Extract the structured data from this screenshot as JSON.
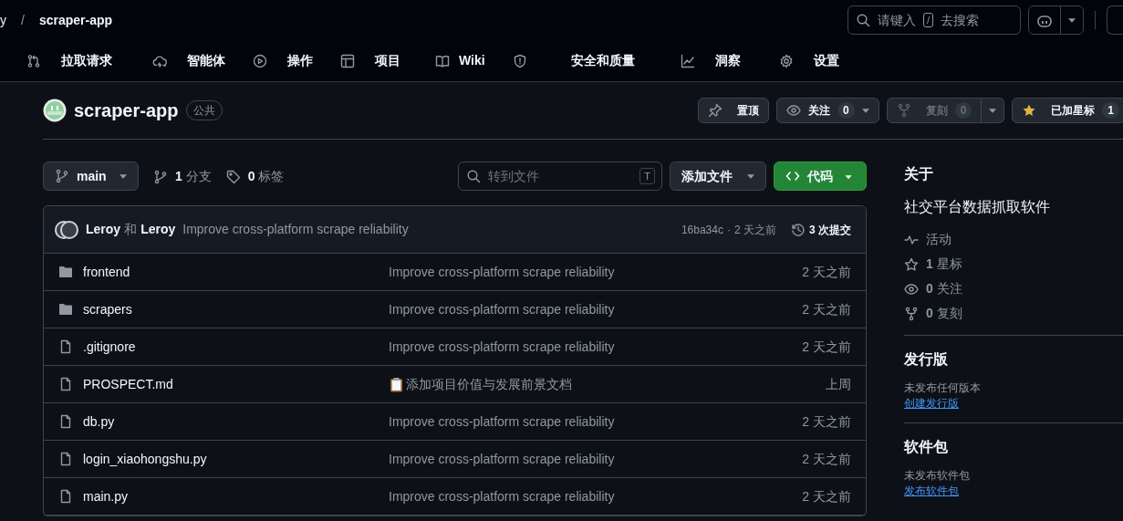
{
  "header": {
    "owner": "y",
    "separator": "/",
    "repo": "scraper-app",
    "search": {
      "before": "请键入",
      "key": "/",
      "after": "去搜索"
    }
  },
  "tabs": [
    {
      "kind": "pulls",
      "label": "拉取请求"
    },
    {
      "kind": "agents",
      "label": "智能体"
    },
    {
      "kind": "actions",
      "label": "操作"
    },
    {
      "kind": "projects",
      "label": "项目"
    },
    {
      "kind": "wiki",
      "label": "Wiki"
    },
    {
      "kind": "security",
      "label": "安全和质量"
    },
    {
      "kind": "insights",
      "label": "洞察"
    },
    {
      "kind": "settings",
      "label": "设置"
    }
  ],
  "repo": {
    "name": "scraper-app",
    "visibility": "公共",
    "actions": [
      {
        "kind": "pin",
        "label": "置顶",
        "disabled": false
      },
      {
        "kind": "watch",
        "label": "关注",
        "count": "0",
        "disabled": false
      },
      {
        "kind": "fork",
        "label": "复刻",
        "count": "0",
        "disabled": true
      },
      {
        "kind": "star",
        "label": "已加星标",
        "count": "1",
        "disabled": false,
        "starred": true
      }
    ]
  },
  "toolbar": {
    "branch": "main",
    "branches": {
      "count": "1",
      "label": "分支"
    },
    "tags": {
      "count": "0",
      "label": "标签"
    },
    "goto": {
      "placeholder": "转到文件",
      "key": "T"
    },
    "add_file": "添加文件",
    "code": "代码"
  },
  "commit": {
    "authors": [
      "Leroy",
      "Leroy"
    ],
    "joiner": "和",
    "message": "Improve cross-platform scrape reliability",
    "hash": "16ba34c",
    "separator": "·",
    "time": "2 天之前",
    "history": "3 次提交"
  },
  "files": [
    {
      "kind": "dir",
      "name": "frontend",
      "message": "Improve cross-platform scrape reliability",
      "has_icon": false,
      "time": "2 天之前"
    },
    {
      "kind": "dir",
      "name": "scrapers",
      "message": "Improve cross-platform scrape reliability",
      "has_icon": false,
      "time": "2 天之前"
    },
    {
      "kind": "file",
      "name": ".gitignore",
      "message": "Improve cross-platform scrape reliability",
      "has_icon": false,
      "time": "2 天之前"
    },
    {
      "kind": "file",
      "name": "PROSPECT.md",
      "message": "添加项目价值与发展前景文档",
      "has_icon": true,
      "time": "上周"
    },
    {
      "kind": "file",
      "name": "db.py",
      "message": "Improve cross-platform scrape reliability",
      "has_icon": false,
      "time": "2 天之前"
    },
    {
      "kind": "file",
      "name": "login_xiaohongshu.py",
      "message": "Improve cross-platform scrape reliability",
      "has_icon": false,
      "time": "2 天之前"
    },
    {
      "kind": "file",
      "name": "main.py",
      "message": "Improve cross-platform scrape reliability",
      "has_icon": false,
      "time": "2 天之前"
    }
  ],
  "sidebar": {
    "about": {
      "title": "关于",
      "description": "社交平台数据抓取软件",
      "stats": [
        {
          "kind": "activity",
          "label": "活动"
        },
        {
          "kind": "stars",
          "count": "1",
          "label": "星标"
        },
        {
          "kind": "watchers",
          "count": "0",
          "label": "关注"
        },
        {
          "kind": "forks",
          "count": "0",
          "label": "复刻"
        }
      ]
    },
    "releases": {
      "title": "发行版",
      "note": "未发布任何版本",
      "link": "创建发行版"
    },
    "packages": {
      "title": "软件包",
      "note": "未发布软件包",
      "link": "发布软件包"
    }
  }
}
